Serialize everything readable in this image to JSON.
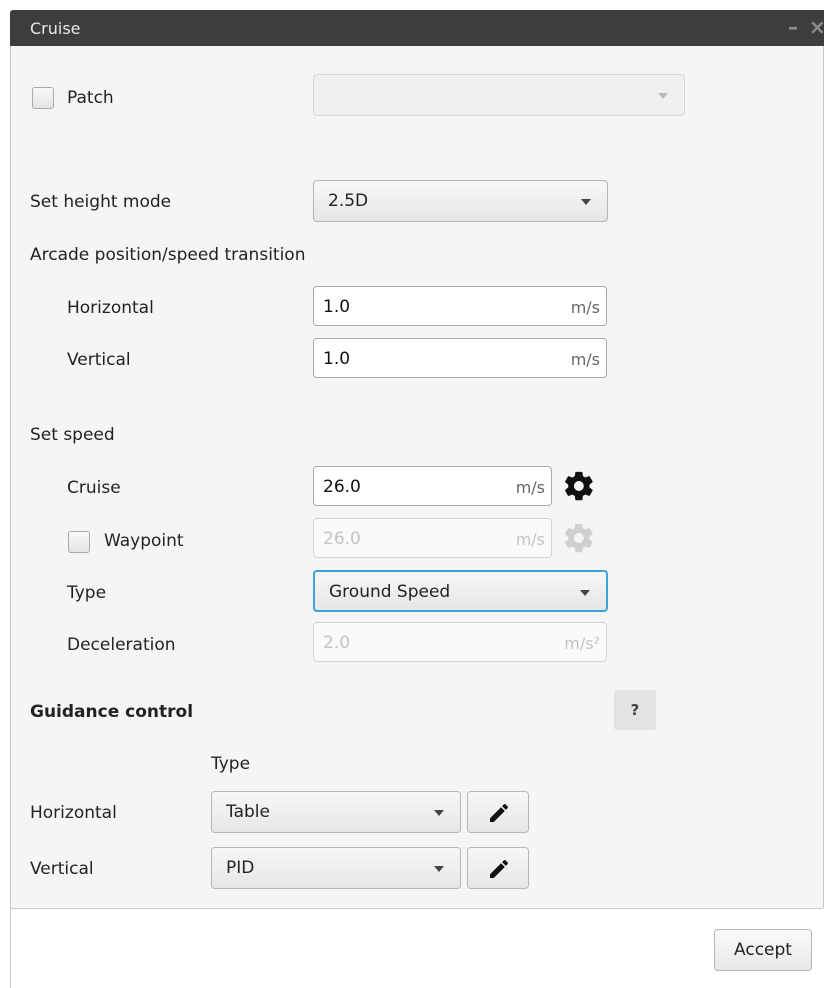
{
  "window": {
    "title": "Cruise"
  },
  "patch": {
    "label": "Patch",
    "checked": false,
    "select_value": ""
  },
  "height_mode": {
    "label": "Set height mode",
    "value": "2.5D"
  },
  "arcade": {
    "label": "Arcade position/speed transition",
    "horizontal": {
      "label": "Horizontal",
      "value": "1.0",
      "unit": "m/s"
    },
    "vertical": {
      "label": "Vertical",
      "value": "1.0",
      "unit": "m/s"
    }
  },
  "speed": {
    "label": "Set speed",
    "cruise": {
      "label": "Cruise",
      "value": "26.0",
      "unit": "m/s"
    },
    "waypoint": {
      "label": "Waypoint",
      "checked": false,
      "value": "26.0",
      "unit": "m/s"
    },
    "type": {
      "label": "Type",
      "value": "Ground Speed"
    },
    "deceleration": {
      "label": "Deceleration",
      "value": "2.0",
      "unit": "m/s²"
    }
  },
  "guidance": {
    "label": "Guidance control",
    "help": "?",
    "type_header": "Type",
    "horizontal": {
      "label": "Horizontal",
      "value": "Table"
    },
    "vertical": {
      "label": "Vertical",
      "value": "PID"
    }
  },
  "footer": {
    "accept_label": "Accept"
  },
  "colors": {
    "titlebar": "#3d3d3d",
    "focus": "#3ba3d6",
    "panel": "#f5f5f5"
  }
}
